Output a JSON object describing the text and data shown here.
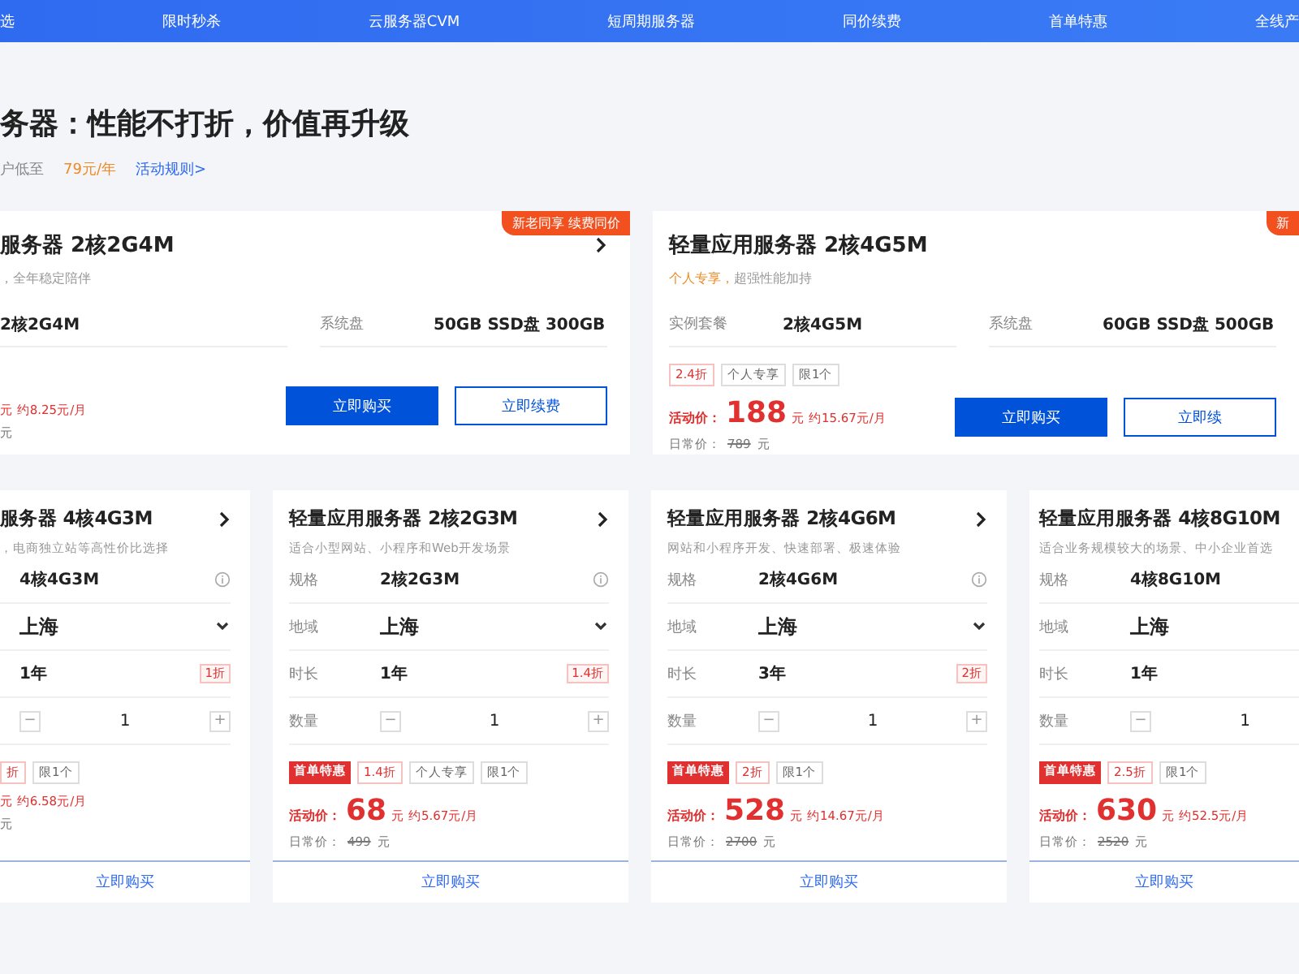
{
  "nav": {
    "items": [
      "选",
      "限时秒杀",
      "云服务器CVM",
      "短周期服务器",
      "同价续费",
      "首单特惠",
      "全线产"
    ]
  },
  "headline": {
    "title": "务器：性能不打折，价值再升级",
    "subtitle": "户低至",
    "price": "79元/年",
    "rules_link": "活动规则>"
  },
  "featured_cards": [
    {
      "ribbon": "新老同享 续费同价",
      "title": "服务器 2核2G4M",
      "subtitle": "，全年稳定陪伴",
      "specs": [
        {
          "value": "2核2G4M"
        },
        {
          "label": "系统盘",
          "value": "50GB SSD盘 300GB"
        }
      ],
      "price_unit": "元 约8.25元/月",
      "regular_unit": "元",
      "buttons": [
        {
          "text": "立即购买",
          "kind": "primary"
        },
        {
          "text": "立即续费",
          "kind": "secondary"
        }
      ]
    },
    {
      "ribbon": "新",
      "title": "轻量应用服务器 2核4G5M",
      "subtitle_highlight": "个人专享，",
      "subtitle": "超强性能加持",
      "specs": [
        {
          "label": "实例套餐",
          "value": "2核4G5M"
        },
        {
          "label": "系统盘",
          "value": "60GB SSD盘 500GB"
        }
      ],
      "tags": [
        {
          "kind": "discount",
          "text": "2.4折"
        },
        {
          "kind": "plain",
          "text": "个人专享"
        },
        {
          "kind": "plain",
          "text": "限1个"
        }
      ],
      "price_label": "活动价：",
      "price": "188",
      "price_unit": "元 约15.67元/月",
      "regular_label": "日常价：",
      "regular_price": "789",
      "regular_unit": "元",
      "buttons": [
        {
          "text": "立即购买",
          "kind": "primary"
        },
        {
          "text": "立即续",
          "kind": "secondary"
        }
      ]
    }
  ],
  "product_cards": [
    {
      "title": "服务器 4核4G3M",
      "subtitle": "，电商独立站等高性价比选择",
      "rows": [
        {
          "kind": "spec",
          "value": "4核4G3M"
        },
        {
          "kind": "region",
          "value": "上海"
        },
        {
          "kind": "duration",
          "value": "1年",
          "badge": "1折"
        },
        {
          "kind": "quantity",
          "minus": "−",
          "value": "1",
          "plus": "+"
        }
      ],
      "tags": [
        {
          "kind": "discount",
          "text": "折"
        },
        {
          "kind": "plain",
          "text": "限1个"
        }
      ],
      "price_unit": "元 约6.58元/月",
      "regular_unit": "元",
      "button": "立即购买"
    },
    {
      "title": "轻量应用服务器 2核2G3M",
      "subtitle": "适合小型网站、小程序和Web开发场景",
      "rows": [
        {
          "kind": "spec",
          "label": "规格",
          "value": "2核2G3M"
        },
        {
          "kind": "region",
          "label": "地域",
          "value": "上海"
        },
        {
          "kind": "duration",
          "label": "时长",
          "value": "1年",
          "badge": "1.4折"
        },
        {
          "kind": "quantity",
          "label": "数量",
          "minus": "−",
          "value": "1",
          "plus": "+"
        }
      ],
      "tags": [
        {
          "kind": "first-order",
          "text": "首单特惠"
        },
        {
          "kind": "discount",
          "text": "1.4折"
        },
        {
          "kind": "plain",
          "text": "个人专享"
        },
        {
          "kind": "plain",
          "text": "限1个"
        }
      ],
      "price_label": "活动价：",
      "price": "68",
      "price_unit": "元 约5.67元/月",
      "regular_label": "日常价：",
      "regular_price": "499",
      "regular_unit": "元",
      "button": "立即购买"
    },
    {
      "title": "轻量应用服务器 2核4G6M",
      "subtitle": "网站和小程序开发、快速部署、极速体验",
      "rows": [
        {
          "kind": "spec",
          "label": "规格",
          "value": "2核4G6M"
        },
        {
          "kind": "region",
          "label": "地域",
          "value": "上海"
        },
        {
          "kind": "duration",
          "label": "时长",
          "value": "3年",
          "badge": "2折"
        },
        {
          "kind": "quantity",
          "label": "数量",
          "minus": "−",
          "value": "1",
          "plus": "+"
        }
      ],
      "tags": [
        {
          "kind": "first-order",
          "text": "首单特惠"
        },
        {
          "kind": "discount",
          "text": "2折"
        },
        {
          "kind": "plain",
          "text": "限1个"
        }
      ],
      "price_label": "活动价：",
      "price": "528",
      "price_unit": "元 约14.67元/月",
      "regular_label": "日常价：",
      "regular_price": "2700",
      "regular_unit": "元",
      "button": "立即购买"
    },
    {
      "title": "轻量应用服务器 4核8G10M",
      "subtitle": "适合业务规模较大的场景、中小企业首选",
      "rows": [
        {
          "kind": "spec",
          "label": "规格",
          "value": "4核8G10M"
        },
        {
          "kind": "region",
          "label": "地域",
          "value": "上海"
        },
        {
          "kind": "duration",
          "label": "时长",
          "value": "1年"
        },
        {
          "kind": "quantity",
          "label": "数量",
          "minus": "−",
          "value": "1"
        }
      ],
      "tags": [
        {
          "kind": "first-order",
          "text": "首单特惠"
        },
        {
          "kind": "discount",
          "text": "2.5折"
        },
        {
          "kind": "plain",
          "text": "限1个"
        }
      ],
      "price_label": "活动价：",
      "price": "630",
      "price_unit": "元 约52.5元/月",
      "regular_label": "日常价：",
      "regular_price": "2520",
      "regular_unit": "元",
      "button": "立即购买"
    }
  ]
}
